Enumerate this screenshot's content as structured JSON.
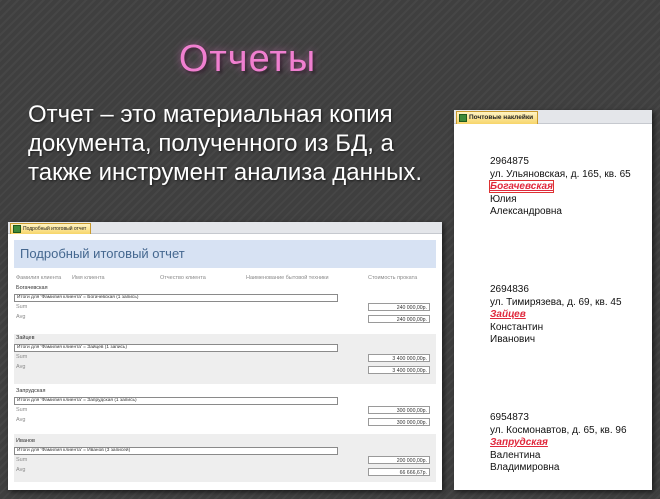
{
  "slide": {
    "title": "Отчеты",
    "body": "Отчет – это материальная копия документа, полученного из БД, а также инструмент анализа данных."
  },
  "colors": {
    "title": "#f07fd0",
    "body": "#ffffff",
    "background": "#3f3f3f",
    "surname": "#e0283c"
  },
  "report": {
    "tab_label": "Подробный итоговый отчет",
    "header": "Подробный итоговый отчет",
    "columns": [
      "Фамилия клиента",
      "Имя клиента",
      "Отчество клиента",
      "Наименование бытовой техники",
      "Стоимость проката"
    ],
    "groups": [
      {
        "name": "Богачевская",
        "summary": "Итоги для 'Фамилия клиента' = Богачевская (1 запись)",
        "sum_label": "Sum",
        "avg_label": "Avg",
        "sum": "240 000,00р.",
        "avg": "240 000,00р."
      },
      {
        "name": "Зайцев",
        "summary": "Итоги для 'Фамилия клиента' = Зайцев (1 запись)",
        "sum_label": "Sum",
        "avg_label": "Avg",
        "sum": "3 400 000,00р.",
        "avg": "3 400 000,00р."
      },
      {
        "name": "Запрудская",
        "summary": "Итоги для 'Фамилия клиента' = Запрудская (1 запись)",
        "sum_label": "Sum",
        "avg_label": "Avg",
        "sum": "300 000,00р.",
        "avg": "300 000,00р."
      },
      {
        "name": "Иванов",
        "summary": "Итоги для 'Фамилия клиента' = Иванов (3 записей)",
        "sum_label": "Sum",
        "avg_label": "Avg",
        "sum": "200 000,00р.",
        "avg": "66 666,67р."
      }
    ]
  },
  "mailing_labels": {
    "tab_label": "Почтовые наклейки",
    "items": [
      {
        "index": "2964875",
        "address": "ул. Ульяновская, д. 165, кв. 65",
        "surname": "Богачевская",
        "name": "Юлия",
        "patronymic": "Александровна"
      },
      {
        "index": "2694836",
        "address": "ул. Тимирязева, д. 69, кв. 45",
        "surname": "Зайцев",
        "name": "Константин",
        "patronymic": "Иванович"
      },
      {
        "index": "6954873",
        "address": "ул. Космонавтов, д. 65, кв. 96",
        "surname": "Запрудская",
        "name": "Валентина",
        "patronymic": "Владимировна"
      }
    ]
  }
}
